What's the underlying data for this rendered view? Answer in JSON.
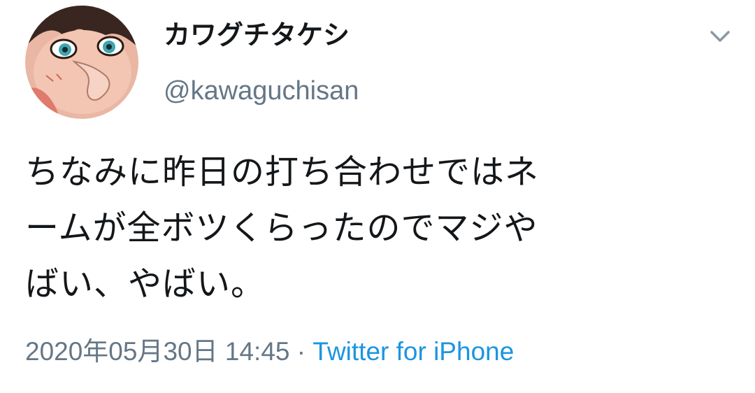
{
  "user": {
    "display_name": "カワグチタケシ",
    "handle": "@kawaguchisan"
  },
  "tweet": {
    "text_lines": [
      "ちなみに昨日の打ち合わせではネ",
      "ームが全ボツくらったのでマジや",
      "ばい、やばい。"
    ],
    "timestamp": "2020年05月30日 14:45",
    "separator": " · ",
    "source": "Twitter for iPhone"
  },
  "icons": {
    "menu": "chevron-down-icon",
    "avatar": "avatar-illustration"
  },
  "colors": {
    "text": "#14171a",
    "muted": "#657786",
    "link": "#1b95e0"
  }
}
